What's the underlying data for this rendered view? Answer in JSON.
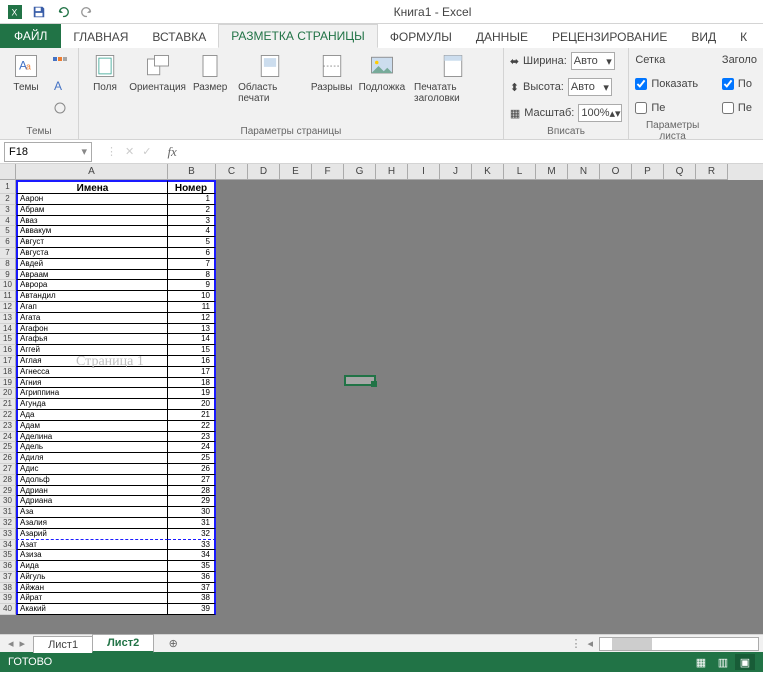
{
  "title": "Книга1 - Excel",
  "qat": {
    "save": "save",
    "undo": "undo",
    "redo": "redo"
  },
  "tabs": {
    "file": "ФАЙЛ",
    "items": [
      "ГЛАВНАЯ",
      "ВСТАВКА",
      "РАЗМЕТКА СТРАНИЦЫ",
      "ФОРМУЛЫ",
      "ДАННЫЕ",
      "РЕЦЕНЗИРОВАНИЕ",
      "ВИД",
      "К"
    ],
    "active_index": 2
  },
  "ribbon": {
    "themes": {
      "label": "Темы",
      "btn": "Темы"
    },
    "page_setup": {
      "label": "Параметры страницы",
      "margins": "Поля",
      "orientation": "Ориентация",
      "size": "Размер",
      "print_area": "Область печати",
      "breaks": "Разрывы",
      "background": "Подложка",
      "print_titles": "Печатать заголовки"
    },
    "scale": {
      "label": "Вписать",
      "width_lbl": "Ширина:",
      "width": "Авто",
      "height_lbl": "Высота:",
      "height": "Авто",
      "scale_lbl": "Масштаб:",
      "scale": "100%"
    },
    "sheet_opts": {
      "grid_lbl": "Сетка",
      "show": "Показать",
      "print": "Пе",
      "head_lbl": "Заголо",
      "show2": "По",
      "print2": "Пе",
      "group": "Параметры листа"
    }
  },
  "namebox": "F18",
  "columns": [
    "A",
    "B",
    "C",
    "D",
    "E",
    "F",
    "G",
    "H",
    "I",
    "J",
    "K",
    "L",
    "M",
    "N",
    "O",
    "P",
    "Q",
    "R"
  ],
  "header_row": {
    "a": "Имена",
    "b": "Номер"
  },
  "rows": [
    {
      "n": 2,
      "a": "Аарон",
      "b": "1"
    },
    {
      "n": 3,
      "a": "Абрам",
      "b": "2"
    },
    {
      "n": 4,
      "a": "Аваз",
      "b": "3"
    },
    {
      "n": 5,
      "a": "Аввакум",
      "b": "4"
    },
    {
      "n": 6,
      "a": "Август",
      "b": "5"
    },
    {
      "n": 7,
      "a": "Августа",
      "b": "6"
    },
    {
      "n": 8,
      "a": "Авдей",
      "b": "7"
    },
    {
      "n": 9,
      "a": "Авраам",
      "b": "8"
    },
    {
      "n": 10,
      "a": "Аврора",
      "b": "9"
    },
    {
      "n": 11,
      "a": "Автандил",
      "b": "10"
    },
    {
      "n": 12,
      "a": "Агап",
      "b": "11"
    },
    {
      "n": 13,
      "a": "Агата",
      "b": "12"
    },
    {
      "n": 14,
      "a": "Агафон",
      "b": "13"
    },
    {
      "n": 15,
      "a": "Агафья",
      "b": "14"
    },
    {
      "n": 16,
      "a": "Аггей",
      "b": "15"
    },
    {
      "n": 17,
      "a": "Аглая",
      "b": "16"
    },
    {
      "n": 18,
      "a": "Агнесса",
      "b": "17"
    },
    {
      "n": 19,
      "a": "Агния",
      "b": "18"
    },
    {
      "n": 20,
      "a": "Агриппина",
      "b": "19"
    },
    {
      "n": 21,
      "a": "Агунда",
      "b": "20"
    },
    {
      "n": 22,
      "a": "Ада",
      "b": "21"
    },
    {
      "n": 23,
      "a": "Адам",
      "b": "22"
    },
    {
      "n": 24,
      "a": "Аделина",
      "b": "23"
    },
    {
      "n": 25,
      "a": "Адель",
      "b": "24"
    },
    {
      "n": 26,
      "a": "Адиля",
      "b": "25"
    },
    {
      "n": 27,
      "a": "Адис",
      "b": "26"
    },
    {
      "n": 28,
      "a": "Адольф",
      "b": "27"
    },
    {
      "n": 29,
      "a": "Адриан",
      "b": "28"
    },
    {
      "n": 30,
      "a": "Адриана",
      "b": "29"
    },
    {
      "n": 31,
      "a": "Аза",
      "b": "30"
    },
    {
      "n": 32,
      "a": "Азалия",
      "b": "31"
    },
    {
      "n": 33,
      "a": "Азарий",
      "b": "32"
    },
    {
      "n": 34,
      "a": "Азат",
      "b": "33"
    },
    {
      "n": 35,
      "a": "Азиза",
      "b": "34"
    },
    {
      "n": 36,
      "a": "Аида",
      "b": "35"
    },
    {
      "n": 37,
      "a": "Айгуль",
      "b": "36"
    },
    {
      "n": 38,
      "a": "Айжан",
      "b": "37"
    },
    {
      "n": 39,
      "a": "Айрат",
      "b": "38"
    },
    {
      "n": 40,
      "a": "Акакий",
      "b": "39"
    }
  ],
  "watermark": "Страница 1",
  "pagebreak_after_row": 33,
  "sheet_tabs": {
    "items": [
      "Лист1",
      "Лист2"
    ],
    "active": 1
  },
  "status": {
    "ready": "ГОТОВО"
  }
}
